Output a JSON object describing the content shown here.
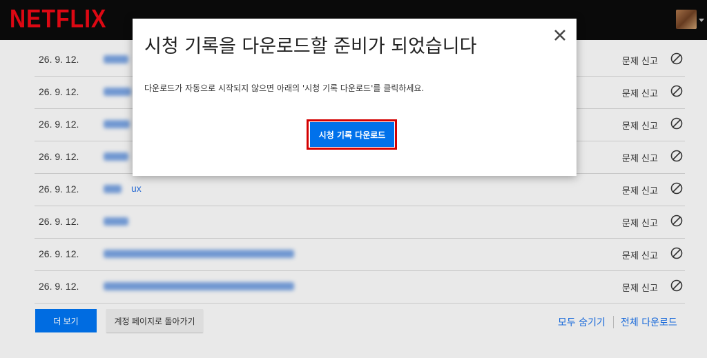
{
  "header": {
    "logo": "NETFLIX"
  },
  "rows": [
    {
      "date": "26. 9. 12.",
      "title": "",
      "report": "문제 신고"
    },
    {
      "date": "26. 9. 12.",
      "title": "",
      "report": "문제 신고"
    },
    {
      "date": "26. 9. 12.",
      "title": "",
      "report": "문제 신고"
    },
    {
      "date": "26. 9. 12.",
      "title": "",
      "report": "문제 신고"
    },
    {
      "date": "26. 9. 12.",
      "title": "ux",
      "report": "문제 신고"
    },
    {
      "date": "26. 9. 12.",
      "title": "",
      "report": "문제 신고"
    },
    {
      "date": "26. 9. 12.",
      "title": "",
      "report": "문제 신고"
    },
    {
      "date": "26. 9. 12.",
      "title": "",
      "report": "문제 신고"
    }
  ],
  "bottom": {
    "more_label": "더 보기",
    "back_label": "계정 페이지로 돌아가기",
    "hide_all_label": "모두 숨기기",
    "download_all_label": "전체 다운로드"
  },
  "modal": {
    "title": "시청 기록을 다운로드할 준비가 되었습니다",
    "text": "다운로드가 자동으로 시작되지 않으면 아래의 '시청 기록 다운로드'를 클릭하세요.",
    "download_label": "시청 기록 다운로드"
  },
  "colors": {
    "brand": "#e50914",
    "accent": "#0071eb",
    "highlight": "#d40000"
  },
  "icons": {
    "close": "close-icon",
    "hide": "hide-circle-slash-icon"
  }
}
